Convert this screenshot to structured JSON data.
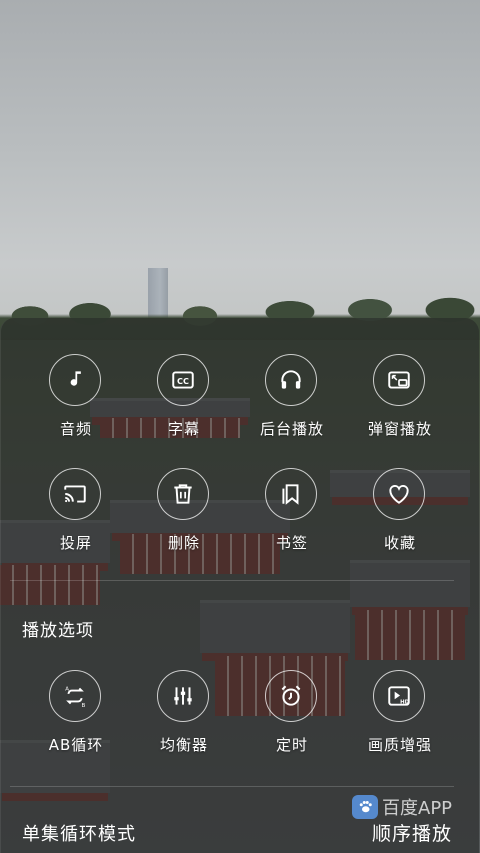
{
  "row1": [
    {
      "label": "音频",
      "icon": "music-note-icon"
    },
    {
      "label": "字幕",
      "icon": "closed-caption-icon"
    },
    {
      "label": "后台播放",
      "icon": "headphones-icon"
    },
    {
      "label": "弹窗播放",
      "icon": "picture-in-picture-icon"
    }
  ],
  "row2": [
    {
      "label": "投屏",
      "icon": "cast-icon"
    },
    {
      "label": "删除",
      "icon": "trash-icon"
    },
    {
      "label": "书签",
      "icon": "bookmark-icon"
    },
    {
      "label": "收藏",
      "icon": "heart-icon"
    }
  ],
  "section_title": "播放选项",
  "row3": [
    {
      "label": "AB循环",
      "icon": "ab-loop-icon"
    },
    {
      "label": "均衡器",
      "icon": "equalizer-icon"
    },
    {
      "label": "定时",
      "icon": "alarm-clock-icon"
    },
    {
      "label": "画质增强",
      "icon": "hd-enhance-icon"
    }
  ],
  "bottom": {
    "loop_mode": "单集循环模式",
    "play_order": "顺序播放"
  },
  "watermark": "百度APP"
}
